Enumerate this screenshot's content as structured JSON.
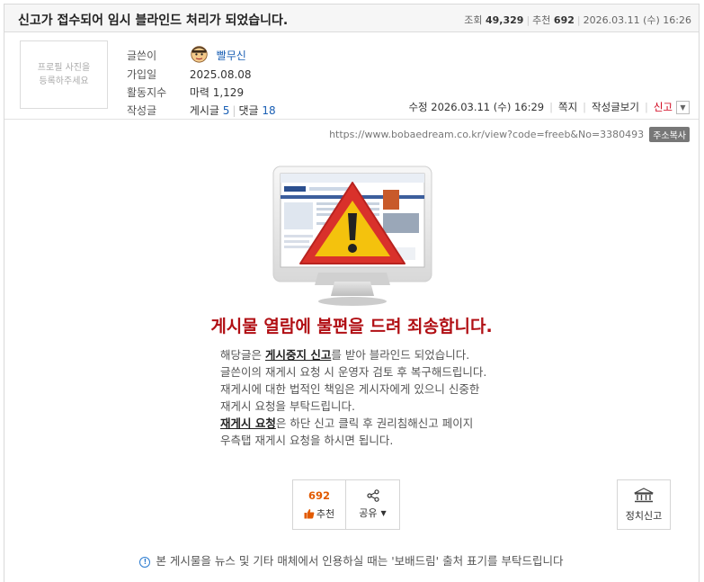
{
  "post": {
    "title": "신고가 접수되어 임시 블라인드 처리가 되었습니다.",
    "views_label": "조회",
    "views": "49,329",
    "recommend_label": "추천",
    "recommend": "692",
    "date": "2026.03.11 (수) 16:26"
  },
  "profile": {
    "photo_placeholder_1": "프로필 사진을",
    "photo_placeholder_2": "등록하주세요",
    "writer_label": "글쓴이",
    "writer": "빨무신",
    "joined_label": "가입일",
    "joined": "2025.08.08",
    "activity_label": "활동지수",
    "activity": "마력 1,129",
    "posts_label": "작성글",
    "posts_prefix": "게시글",
    "posts_count": "5",
    "comments_prefix": "댓글",
    "comments_count": "18"
  },
  "actions": {
    "edited": "수정 2026.03.11 (수) 16:29",
    "message": "쪽지",
    "view_posts": "작성글보기",
    "report": "신고"
  },
  "url": {
    "address": "https://www.bobaedream.co.kr/view?code=freeb&No=3380493",
    "copy_label": "주소복사"
  },
  "notice": {
    "headline": "게시물 열람에 불편을 드려 죄송합니다.",
    "l1_a": "해당글은 ",
    "l1_b": "게시중지 신고",
    "l1_c": "를 받아 블라인드 되었습니다.",
    "l2": "글쓴이의 재게시 요청 시 운영자 검토 후 복구해드립니다.",
    "l3": "재게시에 대한 법적인 책임은 게시자에게 있으니 신중한",
    "l4": "재게시 요청을 부탁드립니다.",
    "l5_a": "재게시 요청",
    "l5_b": "은 하단 신고 클릭 후 권리침해신고 페이지",
    "l6": "우측탭 재게시 요청을 하시면 됩니다."
  },
  "buttons": {
    "recommend_count": "692",
    "recommend_label": "추천",
    "share_label": "공유",
    "police_label": "정치신고"
  },
  "footer": {
    "note": "본 게시물을 뉴스 및 기타 매체에서 인용하실 때는 '보배드림' 출처 표기를 부탁드립니다"
  },
  "colors": {
    "headline": "#b10f14",
    "link": "#1a5fb4",
    "recommend_count": "#e25a00",
    "warning_red": "#d9312b",
    "warning_yellow": "#f4c20d"
  }
}
